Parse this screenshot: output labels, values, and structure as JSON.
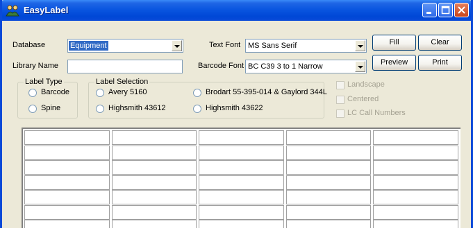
{
  "window": {
    "title": "EasyLabel",
    "accent": "#0a4ad8"
  },
  "form": {
    "database_label": "Database",
    "database_value": "Equipment",
    "library_name_label": "Library Name",
    "library_name_value": "",
    "text_font_label": "Text Font",
    "text_font_value": "MS Sans Serif",
    "barcode_font_label": "Barcode Font",
    "barcode_font_value": "BC C39 3 to 1 Narrow"
  },
  "buttons": {
    "fill": "Fill",
    "clear": "Clear",
    "preview": "Preview",
    "print": "Print"
  },
  "label_type": {
    "title": "Label Type",
    "options": [
      "Barcode",
      "Spine"
    ]
  },
  "label_selection": {
    "title": "Label Selection",
    "options": [
      "Avery 5160",
      "Brodart 55-395-014 & Gaylord 344L",
      "Highsmith 43612",
      "Highsmith 43622"
    ]
  },
  "options": {
    "landscape": "Landscape",
    "centered": "Centered",
    "lc_call_numbers": "LC Call Numbers"
  },
  "grid": {
    "columns": 5,
    "rows": 7
  }
}
